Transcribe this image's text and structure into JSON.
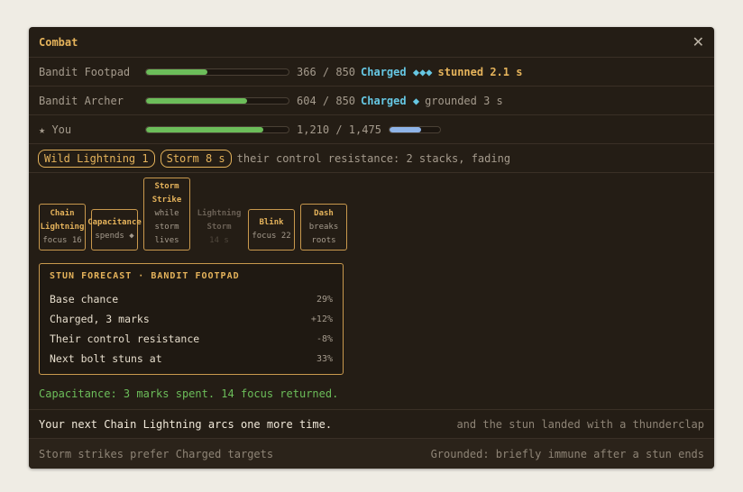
{
  "window": {
    "title": "Combat",
    "close_glyph": "✕"
  },
  "combatants": [
    {
      "name": "Bandit Footpad",
      "hp_fraction": 0.43,
      "hp_text": "366 / 850",
      "charged_label": "Charged",
      "marks": "◆◆◆",
      "status": "stunned 2.1 s",
      "status_kind": "stunned"
    },
    {
      "name": "Bandit Archer",
      "hp_fraction": 0.71,
      "hp_text": "604 / 850",
      "charged_label": "Charged",
      "marks": "◆",
      "status": "grounded 3 s",
      "status_kind": "grounded"
    },
    {
      "name": "★ You",
      "hp_fraction": 0.82,
      "hp_text": "1,210 / 1,475",
      "mana_fraction": 0.63
    }
  ],
  "buffs": {
    "chips": [
      "Wild Lightning 1",
      "Storm 8 s"
    ],
    "note": "their control resistance: 2 stacks, fading"
  },
  "abilities": [
    {
      "name_lines": [
        "Chain",
        "Lightning"
      ],
      "sub_lines": [
        "focus 16"
      ],
      "dim": false
    },
    {
      "name_lines": [
        "Capacitance"
      ],
      "sub_lines": [
        "spends ◆"
      ],
      "dim": false
    },
    {
      "name_lines": [
        "Storm",
        "Strike"
      ],
      "sub_lines": [
        "while",
        "storm",
        "lives"
      ],
      "dim": false
    },
    {
      "name_lines": [
        "Lightning",
        "Storm"
      ],
      "sub_lines": [
        "14 s"
      ],
      "dim": true
    },
    {
      "name_lines": [
        "Blink"
      ],
      "sub_lines": [
        "focus 22"
      ],
      "dim": false
    },
    {
      "name_lines": [
        "Dash"
      ],
      "sub_lines": [
        "breaks",
        "roots"
      ],
      "dim": false
    }
  ],
  "forecast": {
    "title": "STUN FORECAST · BANDIT FOOTPAD",
    "rows": [
      {
        "label": "Base chance",
        "value": "29%"
      },
      {
        "label": "Charged, 3 marks",
        "value": "+12%"
      },
      {
        "label": "Their control resistance",
        "value": "-8%"
      },
      {
        "label": "Next bolt stuns at",
        "value": "33%"
      }
    ]
  },
  "capacitance_note": "Capacitance: 3 marks spent. 14 focus returned.",
  "footer": {
    "primary": "Your next Chain Lightning arcs one more time.",
    "primary_right": "and the stun landed with a thunderclap",
    "hint_left": "Storm strikes prefer Charged targets",
    "hint_right": "Grounded: briefly immune after a stun ends"
  },
  "colors": {
    "accent": "#e5b35b",
    "hp": "#6cbd5a",
    "charged": "#66c7e3",
    "mana": "#8fb4e8",
    "panel": "#241d15"
  }
}
